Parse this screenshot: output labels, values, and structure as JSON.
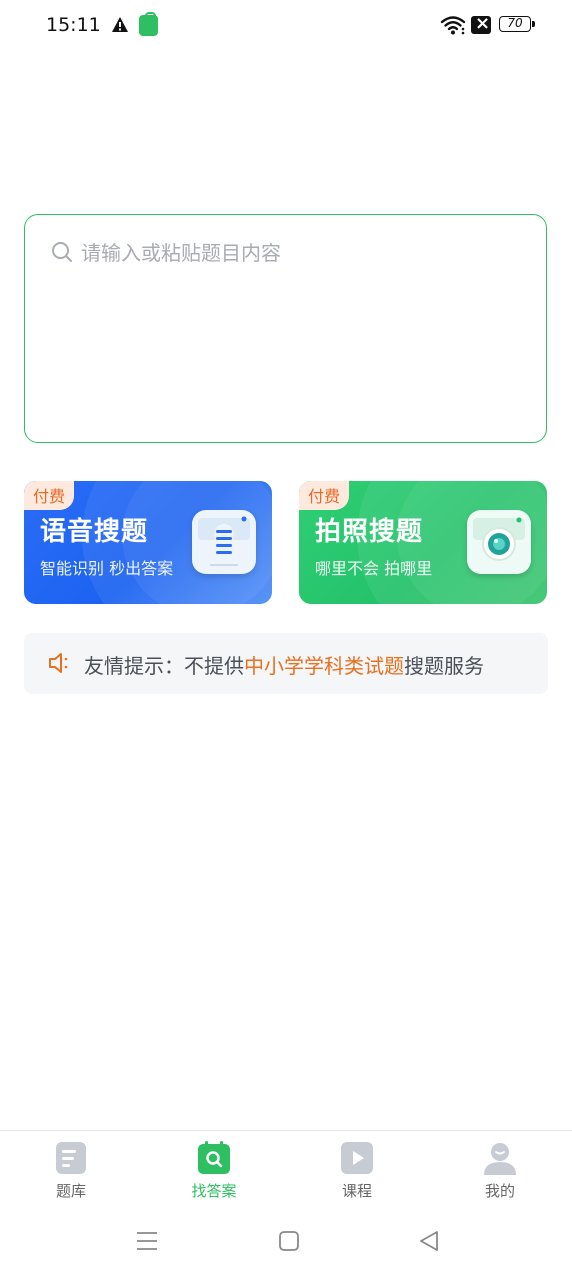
{
  "status_bar": {
    "time": "15:11",
    "battery": "70"
  },
  "search": {
    "placeholder": "请输入或粘贴题目内容"
  },
  "cards": [
    {
      "badge": "付费",
      "title": "语音搜题",
      "subtitle": "智能识别 秒出答案",
      "icon": "microphone-icon"
    },
    {
      "badge": "付费",
      "title": "拍照搜题",
      "subtitle": "哪里不会 拍哪里",
      "icon": "camera-icon"
    }
  ],
  "notice": {
    "prefix": "友情提示：不提供",
    "highlight": "中小学学科类试题",
    "suffix": "搜题服务",
    "highlight_color": "#e8701f"
  },
  "tabs": [
    {
      "label": "题库",
      "icon": "document-icon",
      "active": false
    },
    {
      "label": "找答案",
      "icon": "search-answer-icon",
      "active": true
    },
    {
      "label": "课程",
      "icon": "play-icon",
      "active": false
    },
    {
      "label": "我的",
      "icon": "user-icon",
      "active": false
    }
  ],
  "colors": {
    "accent": "#2dbf62",
    "voice_card": "#1c63f2",
    "photo_card": "#24c26a",
    "badge_text": "#e86a27"
  }
}
